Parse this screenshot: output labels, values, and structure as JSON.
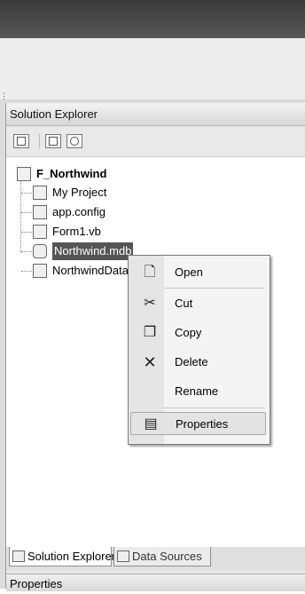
{
  "solution_explorer": {
    "title": "Solution Explorer",
    "toolbar_icons": [
      "properties-icon",
      "show-all-files-icon",
      "refresh-icon"
    ],
    "tree": {
      "root": "F_Northwind",
      "items": [
        {
          "label": "My Project",
          "icon": "my-project-icon"
        },
        {
          "label": "app.config",
          "icon": "config-file-icon"
        },
        {
          "label": "Form1.vb",
          "icon": "form-icon"
        },
        {
          "label": "Northwind.mdb",
          "icon": "database-icon",
          "selected": true
        },
        {
          "label": "NorthwindDataSet.xsd",
          "icon": "dataset-icon"
        }
      ]
    }
  },
  "context_menu": {
    "items": [
      {
        "label": "Open",
        "icon": "open-document-icon"
      },
      {
        "label": "Cut",
        "icon": "scissors-icon"
      },
      {
        "label": "Copy",
        "icon": "copy-icon"
      },
      {
        "label": "Delete",
        "icon": "delete-x-icon"
      },
      {
        "label": "Rename",
        "icon": ""
      },
      {
        "label": "Properties",
        "icon": "properties-icon",
        "highlighted": true
      }
    ]
  },
  "tabs": [
    {
      "label": "Solution Explorer",
      "icon": "solution-explorer-icon",
      "active": true
    },
    {
      "label": "Data Sources",
      "icon": "data-sources-icon",
      "active": false
    }
  ],
  "properties_panel": {
    "title": "Properties"
  }
}
